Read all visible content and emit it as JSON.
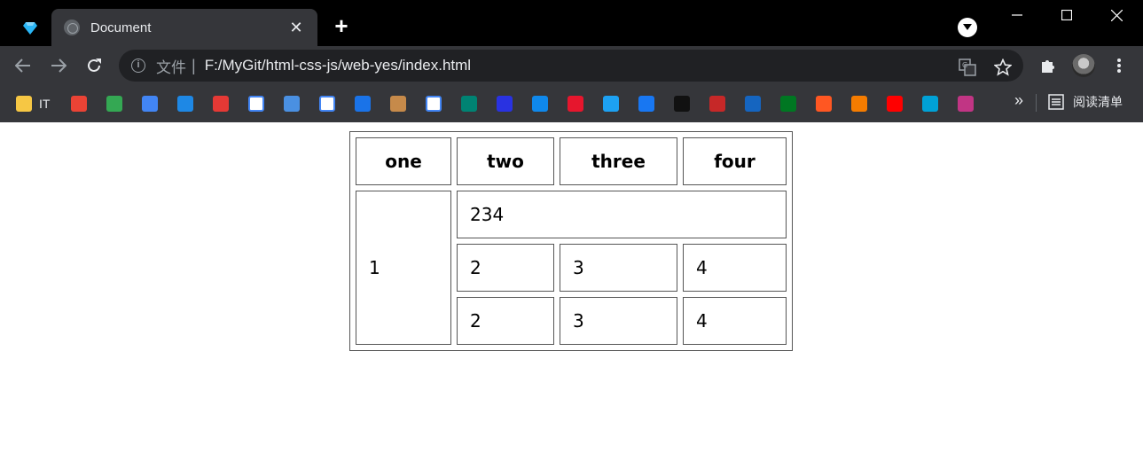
{
  "browser": {
    "tab": {
      "title": "Document",
      "close_glyph": "✕"
    },
    "new_tab_glyph": "+",
    "address_bar": {
      "scheme_label": "文件",
      "separator": "|",
      "url": "F:/MyGit/html-css-js/web-yes/index.html"
    },
    "bookmarks": [
      {
        "name": "folder-it",
        "label": "IT",
        "color": "#f6c744"
      },
      {
        "name": "gmail",
        "label": "",
        "color": "#ea4335"
      },
      {
        "name": "chrome",
        "label": "",
        "color": "#34a853"
      },
      {
        "name": "google-translate",
        "label": "",
        "color": "#4285f4"
      },
      {
        "name": "translate-yi",
        "label": "",
        "color": "#1e88e5"
      },
      {
        "name": "youdao",
        "label": "",
        "color": "#e53935"
      },
      {
        "name": "bookmark-red-map",
        "label": "",
        "color": "#ffffff"
      },
      {
        "name": "google-earth",
        "label": "",
        "color": "#4a90e2"
      },
      {
        "name": "bookmark-fluid",
        "label": "",
        "color": "#ffffff"
      },
      {
        "name": "cloud",
        "label": "",
        "color": "#1a73e8"
      },
      {
        "name": "acorn",
        "label": "",
        "color": "#c68a4a"
      },
      {
        "name": "google",
        "label": "",
        "color": "#ffffff"
      },
      {
        "name": "bing",
        "label": "",
        "color": "#008373"
      },
      {
        "name": "baidu",
        "label": "",
        "color": "#2932e1"
      },
      {
        "name": "zhihu",
        "label": "",
        "color": "#0f88eb"
      },
      {
        "name": "weibo",
        "label": "",
        "color": "#e6162d"
      },
      {
        "name": "twitter",
        "label": "",
        "color": "#1da1f2"
      },
      {
        "name": "facebook",
        "label": "",
        "color": "#1877f2"
      },
      {
        "name": "bookmark-c",
        "label": "",
        "color": "#111111"
      },
      {
        "name": "bookmark-red-globe",
        "label": "",
        "color": "#c62828"
      },
      {
        "name": "bookmark-jia",
        "label": "",
        "color": "#1565c0"
      },
      {
        "name": "douban",
        "label": "",
        "color": "#007722"
      },
      {
        "name": "bookmark-ting",
        "label": "",
        "color": "#ff5722"
      },
      {
        "name": "bookmark-orange",
        "label": "",
        "color": "#f57c00"
      },
      {
        "name": "youtube",
        "label": "",
        "color": "#ff0000"
      },
      {
        "name": "bilibili",
        "label": "",
        "color": "#00a1d6"
      },
      {
        "name": "instagram",
        "label": "",
        "color": "#c13584"
      }
    ],
    "more_glyph": "»",
    "reading_list_label": "阅读清单"
  },
  "page": {
    "table": {
      "headers": [
        "one",
        "two",
        "three",
        "four"
      ],
      "row1": {
        "first_cell": "1",
        "merged_cell": "234"
      },
      "row2": [
        "2",
        "3",
        "4"
      ],
      "row3": [
        "2",
        "3",
        "4"
      ]
    }
  }
}
